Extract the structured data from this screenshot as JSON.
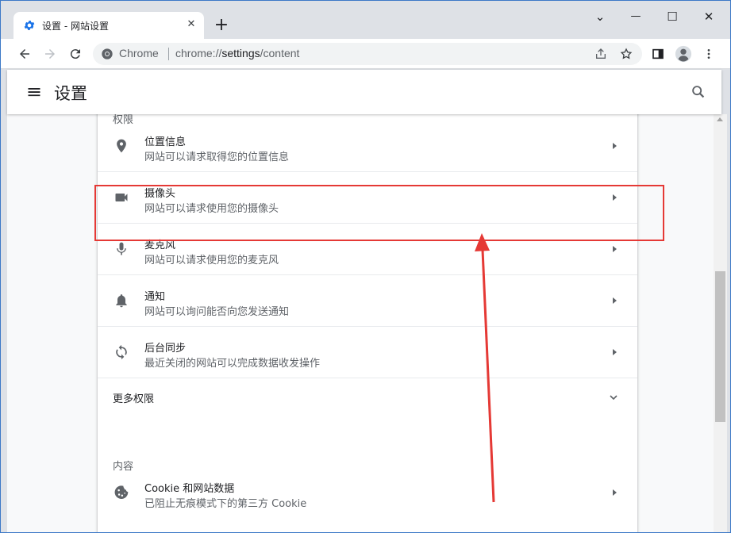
{
  "window": {
    "controls": {
      "collapse": "⌄",
      "minimize": "—",
      "maximize": "☐",
      "close": "✕"
    }
  },
  "tab": {
    "title": "设置 - 网站设置",
    "close": "✕",
    "icon": "gear-icon",
    "new_tab": "+"
  },
  "toolbar": {
    "chip_label": "Chrome",
    "url_scheme": "chrome://",
    "url_host": "settings",
    "url_path": "/content"
  },
  "header": {
    "title": "设置"
  },
  "permissions": {
    "section_label": "权限",
    "items": [
      {
        "title": "位置信息",
        "subtitle": "网站可以请求取得您的位置信息",
        "icon": "location-pin-icon"
      },
      {
        "title": "摄像头",
        "subtitle": "网站可以请求使用您的摄像头",
        "icon": "camera-icon"
      },
      {
        "title": "麦克风",
        "subtitle": "网站可以请求使用您的麦克风",
        "icon": "microphone-icon"
      },
      {
        "title": "通知",
        "subtitle": "网站可以询问能否向您发送通知",
        "icon": "bell-icon"
      },
      {
        "title": "后台同步",
        "subtitle": "最近关闭的网站可以完成数据收发操作",
        "icon": "sync-icon"
      }
    ],
    "more_label": "更多权限"
  },
  "content": {
    "section_label": "内容",
    "items": [
      {
        "title": "Cookie 和网站数据",
        "subtitle": "已阻止无痕模式下的第三方 Cookie",
        "icon": "cookie-icon"
      }
    ]
  },
  "colors": {
    "accent": "#1a73e8",
    "annotation": "#e53935"
  }
}
